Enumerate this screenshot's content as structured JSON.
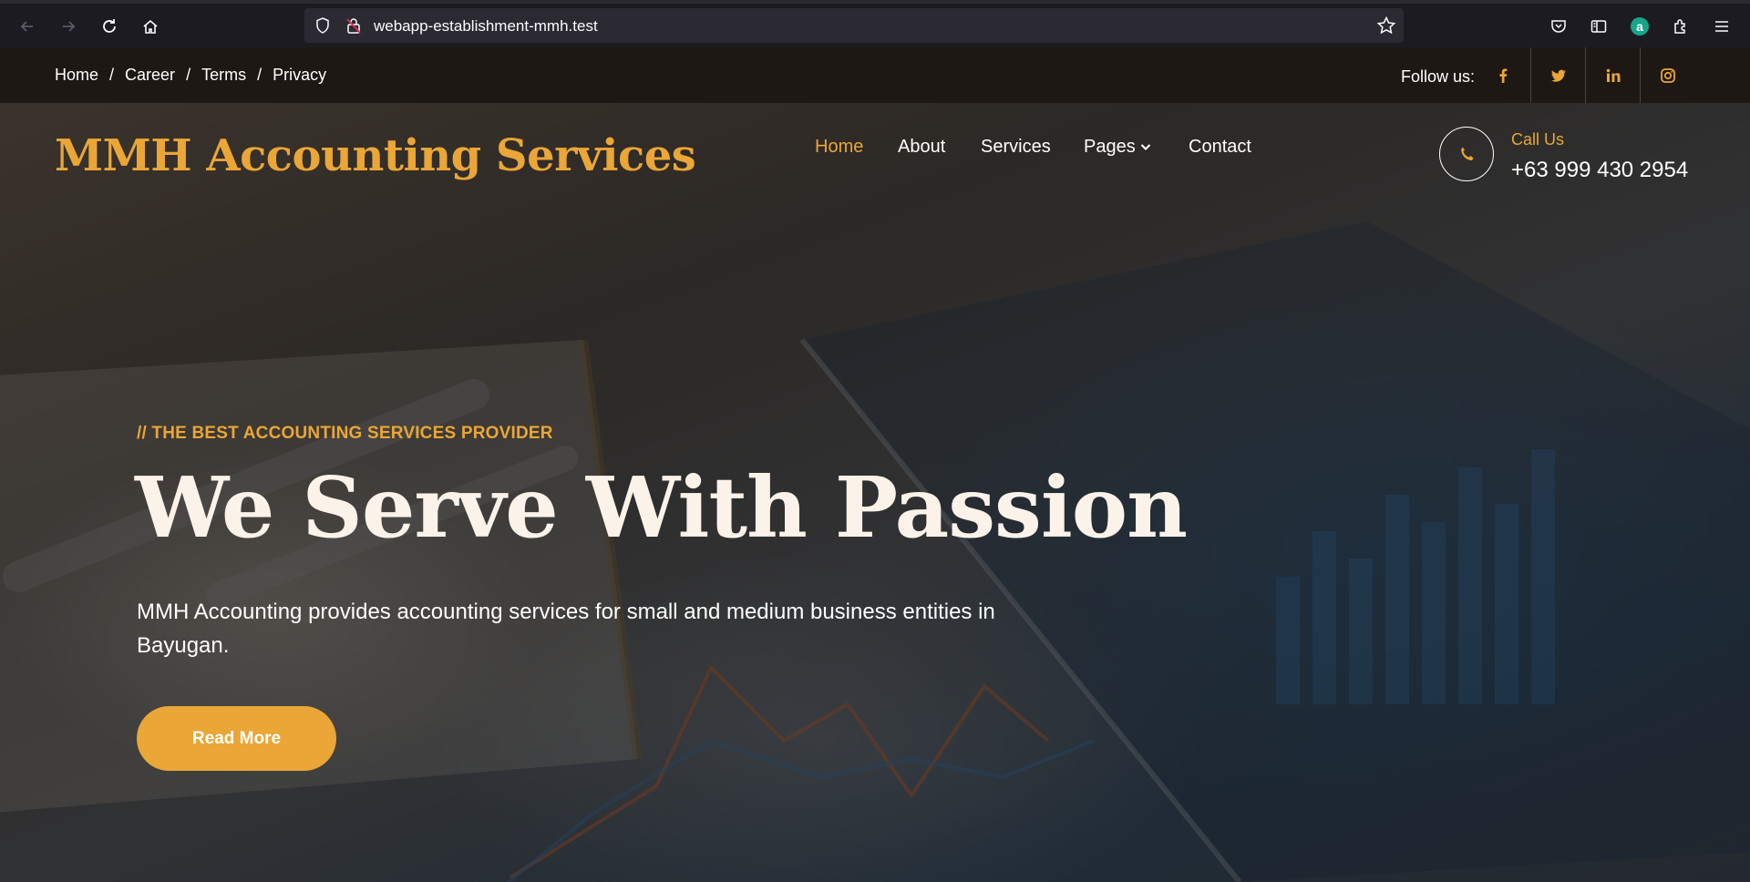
{
  "browser": {
    "url": "webapp-establishment-mmh.test",
    "extension_letter": "a"
  },
  "topbar": {
    "breadcrumb": [
      {
        "label": "Home"
      },
      {
        "label": "Career"
      },
      {
        "label": "Terms"
      },
      {
        "label": "Privacy"
      }
    ],
    "separator": "/",
    "follow_label": "Follow us:",
    "socials": [
      "facebook-icon",
      "twitter-icon",
      "linkedin-icon",
      "instagram-icon"
    ]
  },
  "header": {
    "brand": "MMH Accounting Services",
    "nav": [
      {
        "label": "Home",
        "active": true
      },
      {
        "label": "About"
      },
      {
        "label": "Services"
      },
      {
        "label": "Pages",
        "dropdown": true
      },
      {
        "label": "Contact"
      }
    ],
    "call_label": "Call Us",
    "call_number": "+63 999 430 2954"
  },
  "hero": {
    "eyebrow": "// THE BEST ACCOUNTING SERVICES PROVIDER",
    "headline": "We Serve With Passion",
    "lead": "MMH Accounting provides accounting services for small and medium business entities in Bayugan.",
    "cta_label": "Read More"
  },
  "colors": {
    "accent": "#eaa636",
    "topbar_bg": "#1e1814",
    "browser_bg": "#1c1b22"
  }
}
